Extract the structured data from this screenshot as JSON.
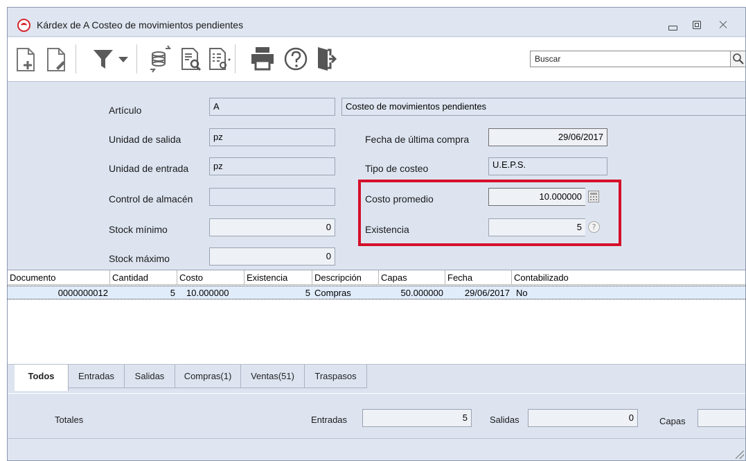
{
  "window": {
    "title": "Kárdex de  A  Costeo de movimientos pendientes"
  },
  "toolbar": {
    "search_placeholder": "Buscar"
  },
  "form": {
    "articulo_label": "Artículo",
    "articulo_value": "A",
    "descripcion_value": "Costeo de movimientos pendientes",
    "unidad_salida_label": "Unidad de salida",
    "unidad_salida_value": "pz",
    "unidad_entrada_label": "Unidad de entrada",
    "unidad_entrada_value": "pz",
    "control_almacen_label": "Control de almacén",
    "control_almacen_value": "",
    "stock_minimo_label": "Stock mínimo",
    "stock_minimo_value": "0",
    "stock_maximo_label": "Stock máximo",
    "stock_maximo_value": "0",
    "fecha_compra_label": "Fecha de última compra",
    "fecha_compra_value": "29/06/2017",
    "tipo_costeo_label": "Tipo de costeo",
    "tipo_costeo_value": "U.E.P.S.",
    "costo_promedio_label": "Costo promedio",
    "costo_promedio_value": "10.000000",
    "existencia_label": "Existencia",
    "existencia_value": "5"
  },
  "grid": {
    "columns": [
      "Documento",
      "Cantidad",
      "Costo",
      "Existencia",
      "Descripción",
      "Capas",
      "Fecha",
      "Contabilizado"
    ],
    "rows": [
      [
        "0000000012",
        "5",
        "10.000000",
        "5",
        "Compras",
        "50.000000",
        "29/06/2017",
        "No"
      ]
    ]
  },
  "tabs": [
    "Todos",
    "Entradas",
    "Salidas",
    "Compras(1)",
    "Ventas(51)",
    "Traspasos"
  ],
  "totals": {
    "title": "Totales",
    "entradas_label": "Entradas",
    "entradas_value": "5",
    "salidas_label": "Salidas",
    "salidas_value": "0",
    "capas_label": "Capas",
    "capas_value": ""
  },
  "colors": {
    "highlight": "#d4102a",
    "window_bg": "#dde4f0",
    "selected_row": "#e1ecfb"
  }
}
